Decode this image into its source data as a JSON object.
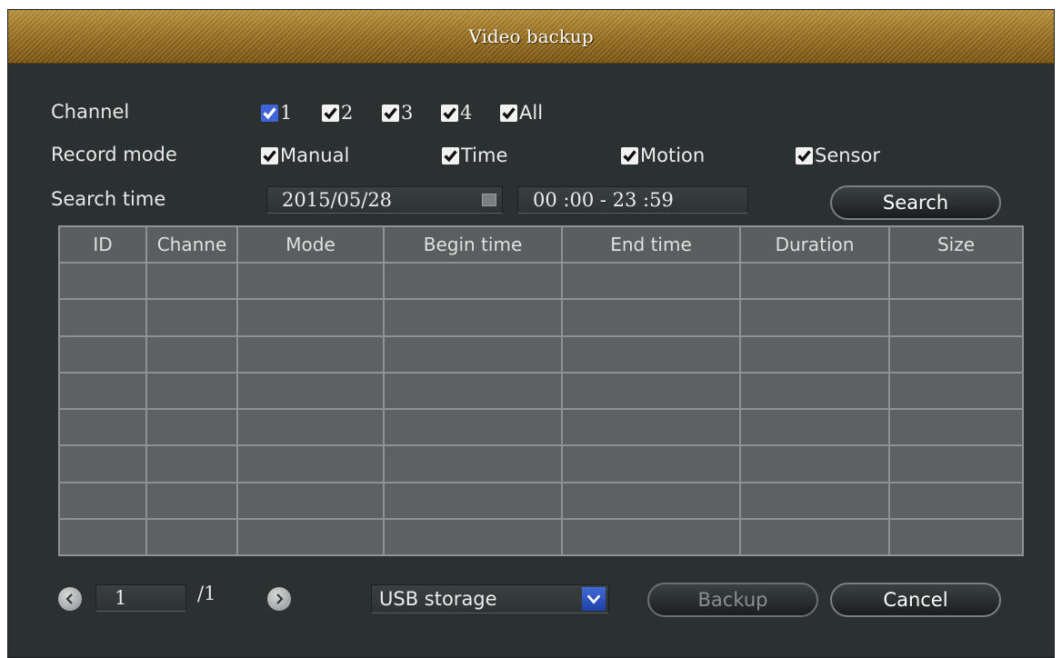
{
  "window": {
    "title": "Video backup"
  },
  "channel": {
    "label": "Channel",
    "options": [
      {
        "label": "1",
        "checked": true,
        "focused": true
      },
      {
        "label": "2",
        "checked": true
      },
      {
        "label": "3",
        "checked": true
      },
      {
        "label": "4",
        "checked": true
      },
      {
        "label": "All",
        "checked": true
      }
    ]
  },
  "record_mode": {
    "label": "Record mode",
    "options": [
      {
        "label": "Manual",
        "checked": true
      },
      {
        "label": "Time",
        "checked": true
      },
      {
        "label": "Motion",
        "checked": true
      },
      {
        "label": "Sensor",
        "checked": true
      }
    ]
  },
  "search_time": {
    "label": "Search time",
    "date": "2015/05/28",
    "time_range": "00 :00 - 23 :59"
  },
  "search_button": "Search",
  "table": {
    "columns": [
      "ID",
      "Channe",
      "Mode",
      "Begin time",
      "End time",
      "Duration",
      "Size"
    ],
    "rows": []
  },
  "pager": {
    "current_page": "1",
    "total_label": "/1"
  },
  "storage_select": {
    "value": "USB storage"
  },
  "backup_button": "Backup",
  "cancel_button": "Cancel",
  "colors": {
    "title_bar": "#946c1e",
    "panel": "#2b3030",
    "focus_checkbox": "#3f63d8"
  }
}
